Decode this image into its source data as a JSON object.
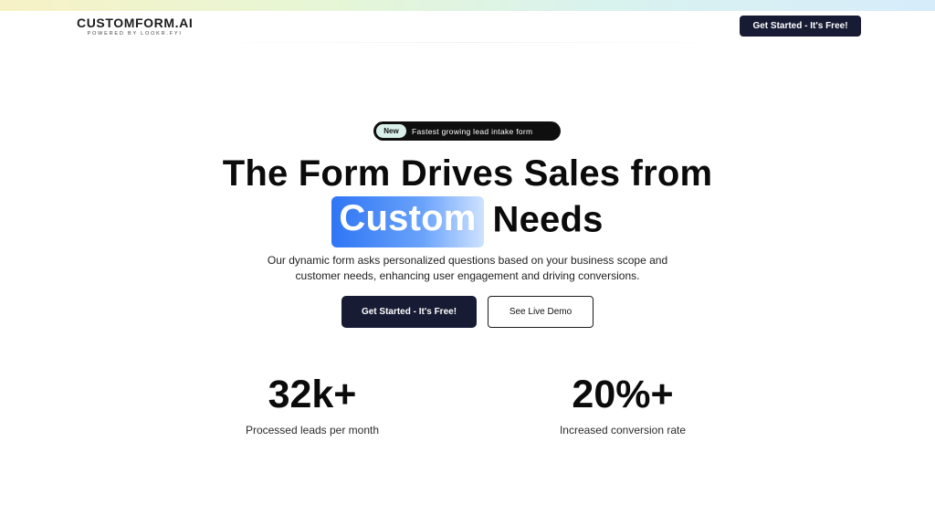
{
  "header": {
    "brand_name": "CUSTOMFORM.AI",
    "brand_sub": "POWERED BY LOOKR.FYI",
    "cta_label": "Get Started - It's Free!"
  },
  "hero": {
    "badge_pill": "New",
    "badge_text": "Fastest growing lead intake form",
    "headline_line1": "The Form Drives Sales from",
    "headline_highlight": "Custom",
    "headline_rest": "Needs",
    "subtitle_line1": "Our dynamic form asks personalized questions based on your business scope and",
    "subtitle_line2": "customer needs, enhancing user engagement and driving conversions.",
    "primary_cta": "Get Started - It's Free!",
    "secondary_cta": "See Live Demo"
  },
  "stats": [
    {
      "value": "32k+",
      "label": "Processed leads per month"
    },
    {
      "value": "20%+",
      "label": "Increased conversion rate"
    }
  ],
  "colors": {
    "dark_button": "#171b33",
    "highlight_blue": "#2f75f5",
    "badge_pill": "#d9f0ea"
  }
}
